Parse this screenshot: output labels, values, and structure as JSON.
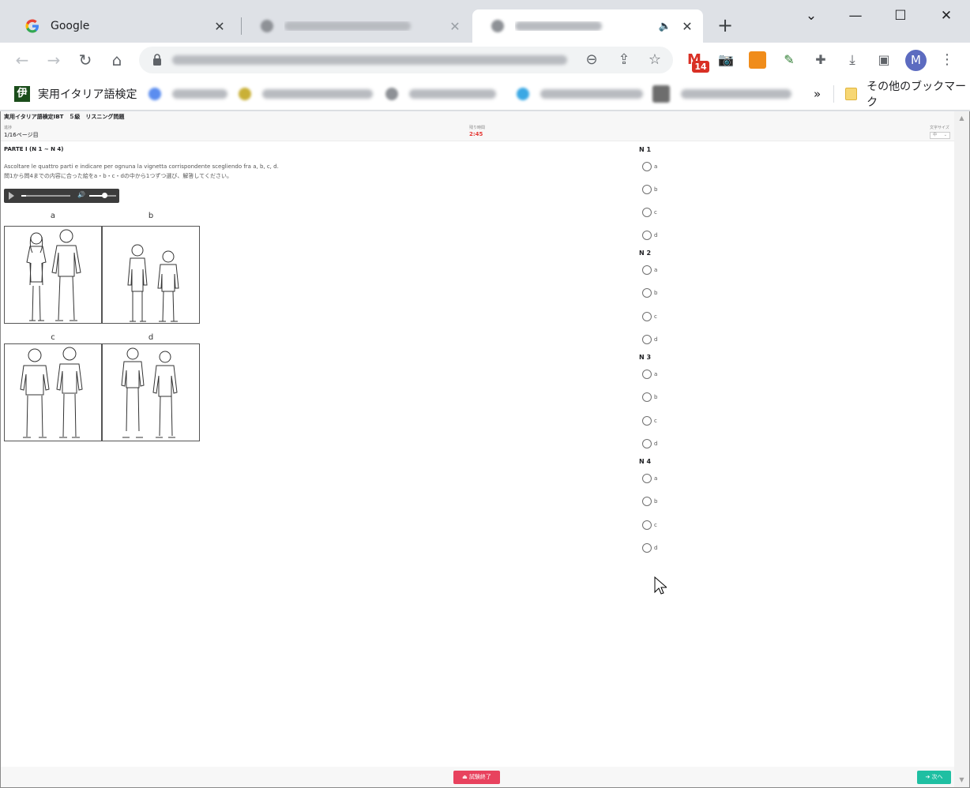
{
  "browser": {
    "tabs": [
      {
        "title": "Google",
        "active": false
      },
      {
        "title": "",
        "active": false
      },
      {
        "title": "",
        "active": true
      }
    ],
    "bookmarks": {
      "first_label": "実用イタリア語検定",
      "first_logo": "伊",
      "overflow": "»",
      "other_label": "その他のブックマーク"
    },
    "avatar_letter": "M",
    "gmail_badge": "14"
  },
  "exam": {
    "title": "実用イタリア語検定IBT　５級　リスニング問題",
    "progress_label": "進捗",
    "progress_value": "1/16ページ目",
    "timer_label": "残り時間",
    "timer_value": "2:45",
    "fontsize_label": "文字サイズ",
    "fontsize_value": "中",
    "part_title": "PARTE I (N 1 ~ N 4)",
    "instruction_it": "Ascoltare le quattro parti e indicare per ognuna la vignetta corrispondente scegliendo fra a, b, c, d.",
    "instruction_ja": "問1から問4までの内容に合った絵をa・b・c・dの中から1つずつ選び、解答してください。",
    "audio": {
      "progress": 0.1,
      "volume": 0.55
    },
    "pictures": [
      {
        "label": "a"
      },
      {
        "label": "b"
      },
      {
        "label": "c"
      },
      {
        "label": "d"
      }
    ],
    "questions": [
      {
        "label": "N 1",
        "options": [
          "a",
          "b",
          "c",
          "d"
        ]
      },
      {
        "label": "N 2",
        "options": [
          "a",
          "b",
          "c",
          "d"
        ]
      },
      {
        "label": "N 3",
        "options": [
          "a",
          "b",
          "c",
          "d"
        ]
      },
      {
        "label": "N 4",
        "options": [
          "a",
          "b",
          "c",
          "d"
        ]
      }
    ],
    "end_button": "試験終了",
    "next_button": "次へ"
  },
  "colors": {
    "accent_end": "#e8425e",
    "accent_next": "#1fbfa2",
    "timer": "#e53935"
  }
}
